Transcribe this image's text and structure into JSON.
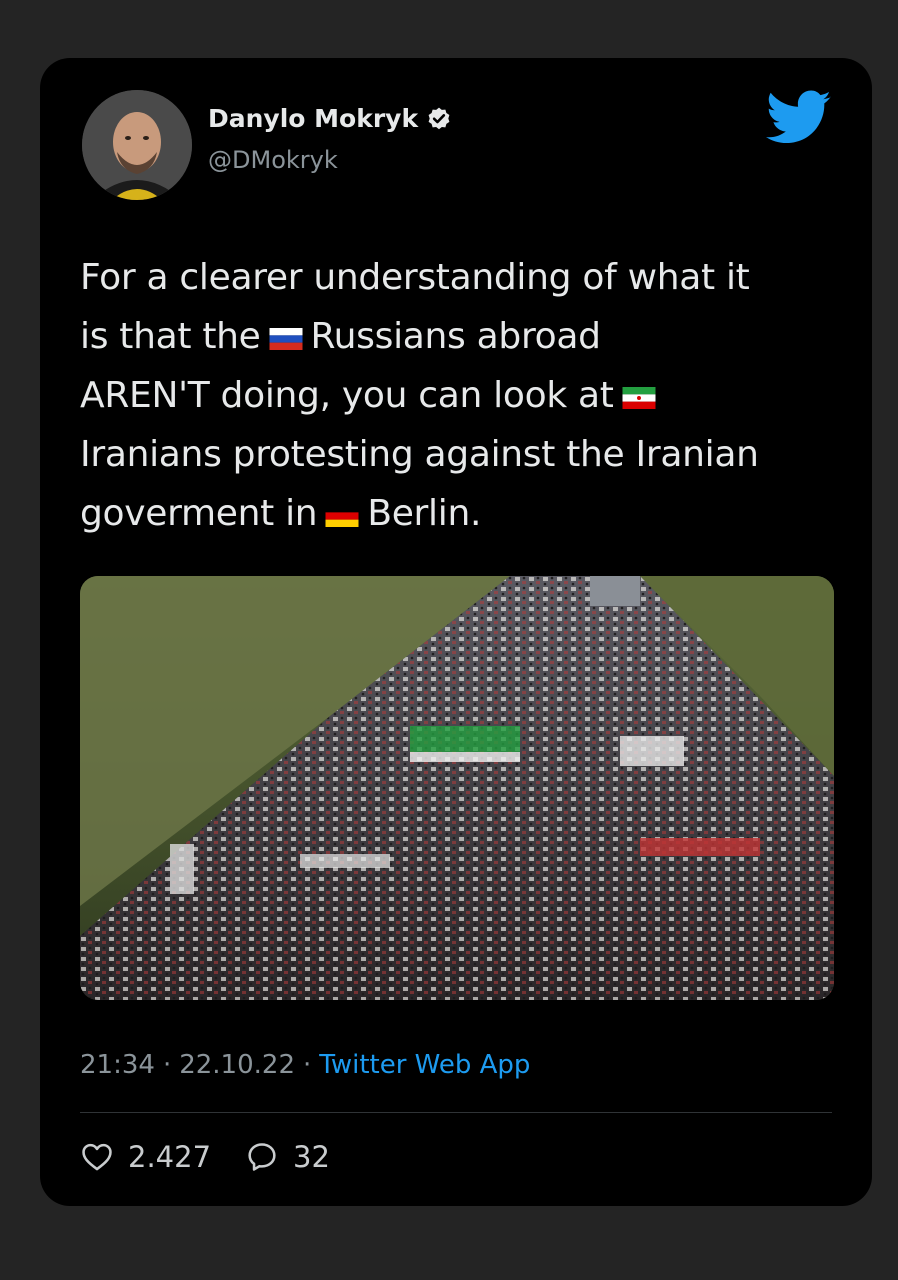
{
  "author": {
    "name": "Danylo Mokryk",
    "handle": "@DMokryk"
  },
  "icons": {
    "verified": "verified-badge-icon",
    "brand": "twitter-bird-icon",
    "like": "heart-icon",
    "reply": "reply-bubble-icon"
  },
  "tweet": {
    "line1": "For a clearer understanding of what it",
    "line2_pre": "is that the",
    "line2_post": "Russians abroad",
    "line3_pre": "AREN'T doing, you can look at",
    "line4": "Iranians protesting against the Iranian",
    "line5_pre": "goverment in",
    "line5_post": "Berlin."
  },
  "flags": {
    "russia": "russia-flag-icon",
    "iran": "iran-flag-icon",
    "germany": "germany-flag-icon"
  },
  "meta": {
    "time": "21:34",
    "sep1": "·",
    "date": "22.10.22",
    "sep2": "·",
    "app": "Twitter Web App"
  },
  "stats": {
    "likes": "2.427",
    "replies": "32"
  },
  "colors": {
    "background": "#242424",
    "card": "#000000",
    "text": "#e7e9ea",
    "muted": "#8b949a",
    "accent": "#1d9bf0"
  }
}
